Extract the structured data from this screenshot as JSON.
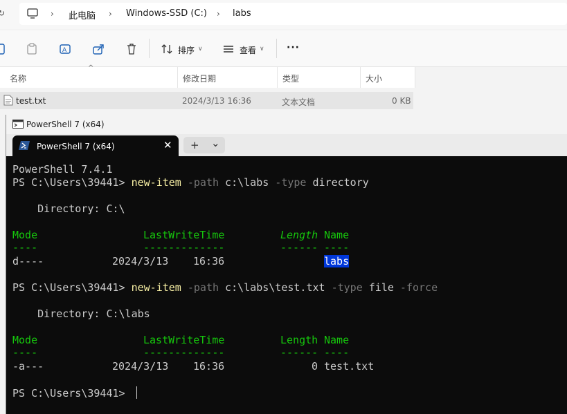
{
  "explorer": {
    "breadcrumb": [
      "此电脑",
      "Windows-SSD (C:)",
      "labs"
    ],
    "toolbar": {
      "sort_label": "排序",
      "view_label": "查看",
      "more_label": "···"
    },
    "columns": [
      "名称",
      "修改日期",
      "类型",
      "大小"
    ],
    "files": [
      {
        "name": "test.txt",
        "modified": "2024/3/13 16:36",
        "type": "文本文档",
        "size": "0 KB"
      }
    ]
  },
  "terminal_window": {
    "title": "PowerShell 7 (x64)",
    "tab_label": "PowerShell 7 (x64)",
    "new_tab_symbol": "+",
    "close_symbol": "✕",
    "dropdown_symbol": "⌄"
  },
  "session": {
    "banner": "PowerShell 7.4.1",
    "prompt": "PS C:\\Users\\39441> ",
    "cmd1": {
      "verb": "new-item",
      "p1": " -path",
      "v1": " c:\\labs",
      "p2": " -type",
      "v2": " directory",
      "p3": ""
    },
    "dir1": "    Directory: C:\\",
    "headers": {
      "mode": "Mode",
      "lwt": "LastWriteTime",
      "length": "Length",
      "name": "Name"
    },
    "dashes": {
      "mode": "----",
      "lwt": "-------------",
      "length": "------",
      "name": "----"
    },
    "row1": {
      "mode": "d----",
      "date": "2024/3/13",
      "time": "16:36",
      "length": "",
      "name": "labs"
    },
    "cmd2": {
      "verb": "new-item",
      "p1": " -path",
      "v1": " c:\\labs\\test.txt",
      "p2": " -type",
      "v2": " file",
      "p3": " -force"
    },
    "dir2": "    Directory: C:\\labs",
    "row2": {
      "mode": "-a---",
      "date": "2024/3/13",
      "time": "16:36",
      "length": "0",
      "name": "test.txt"
    }
  },
  "colors": {
    "accent_selection": "#0037da",
    "header_green": "#16c60c",
    "command_yellow": "#f9f1a5",
    "param_gray": "#767676"
  }
}
